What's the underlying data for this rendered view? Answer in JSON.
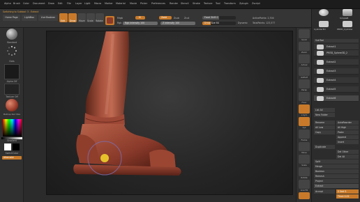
{
  "menubar": {
    "items": [
      "Alpha",
      "Brush",
      "Color",
      "Document",
      "Draw",
      "Edit",
      "File",
      "Layer",
      "Light",
      "Macro",
      "Marker",
      "Material",
      "Movie",
      "Picker",
      "Preferences",
      "Render",
      "Stencil",
      "Stroke",
      "Texture",
      "Tool",
      "Transform",
      "Zplugin",
      "Zscript"
    ]
  },
  "toolbar": {
    "hint": "Switching to Subtool: 3 . Extract",
    "buttons": [
      "Edit",
      "Draw",
      "Move",
      "Scale",
      "Rotate"
    ],
    "rgb_label": "Rgb",
    "mrgb_label": "Mrgb",
    "m_label": "M",
    "zadd_label": "Zadd",
    "zsub_label": "Zsub",
    "zcut_label": "Zcut",
    "rgb_intensity": "Rgb Intensity 100",
    "z_intensity": "Z Intensity 100",
    "focal_shift": "Focal Shift 0",
    "draw_size": "Draw Size 64",
    "dynamic": "Dynamic",
    "active_points": "ActivePoints: 2,304",
    "total_points": "TotalPoints: 123,577"
  },
  "left": {
    "home_page": "Home Page",
    "lightbox": "LightBox",
    "live_boolean": "Live Boolean",
    "brush_label": "Standard",
    "stroke_label": "Dots",
    "alpha_label": "Alpha Off",
    "texture_label": "Texture Off",
    "material_label": "MatCap Red Wax",
    "gradient_label": "Gradient",
    "switch_color": "SwitchColor",
    "alternate": "Alternate"
  },
  "right_shelf": {
    "items": [
      "Scroll",
      "Zoom",
      "Actual",
      "AAHalf",
      "Persp",
      "Floor",
      "L.Sym",
      "Xyz",
      "Frame",
      "Move",
      "Scale",
      "Rotate",
      "Line Fill",
      "Transp",
      "Ghost",
      "Solo",
      "Xpose"
    ]
  },
  "right_panel": {
    "top_tools": [
      "SimpleB",
      "Cylinder3D",
      "PM3D_Cylinder"
    ],
    "subtool_header": "SubTool",
    "subtools": [
      "Extract1",
      "PM3D_Sphere3D_2",
      "Extract2",
      "Extract3",
      "Extract4",
      "Extract5",
      "Extract6"
    ],
    "buttons": [
      "List All",
      "New Folder",
      "Rename",
      "AutoReorder",
      "All Low",
      "All High",
      "Copy",
      "Paste",
      "Append",
      "Insert",
      "Duplicate",
      "Del Other",
      "Del All",
      "Split",
      "Merge",
      "Boolean",
      "Remesh",
      "Project",
      "Extract"
    ],
    "extract_controls": [
      "S Smt 5",
      "Thick 0.02",
      "Accept"
    ]
  },
  "colors": {
    "accent": "#c87a2a",
    "clay": "#9a4a38"
  }
}
